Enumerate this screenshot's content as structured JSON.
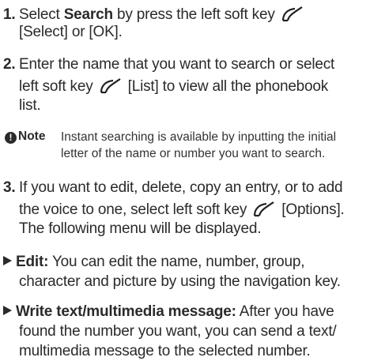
{
  "steps": [
    {
      "num": "1.",
      "parts": [
        "Select ",
        "Search",
        " by press the left soft key",
        "[Select] or [OK]."
      ]
    },
    {
      "num": "2.",
      "parts": [
        "Enter the name that you want to search or select",
        "left soft key ",
        " [List] to view all the phonebook",
        "list."
      ]
    },
    {
      "num": "3.",
      "parts": [
        "If you want to edit, delete, copy an entry, or to add",
        "the voice to one, select left soft key ",
        " [Options].",
        "The following menu will be displayed."
      ]
    }
  ],
  "note": {
    "label": "Note",
    "lines": [
      "Instant searching is available by inputting the initial",
      "letter of the name or number you want to search."
    ]
  },
  "bullets": [
    {
      "title": "Edit:",
      "lines": [
        " You can edit the name, number, group,",
        "character and picture by using the navigation key."
      ]
    },
    {
      "title": "Write text/multimedia message:",
      "lines": [
        " After you have",
        "found the number you want, you can send a text/",
        "multimedia message to the selected number."
      ]
    }
  ],
  "icons": {
    "soft_key": "left-soft-key-icon",
    "note": "note-exclamation-icon",
    "bullet": "triangle-bullet-icon"
  }
}
